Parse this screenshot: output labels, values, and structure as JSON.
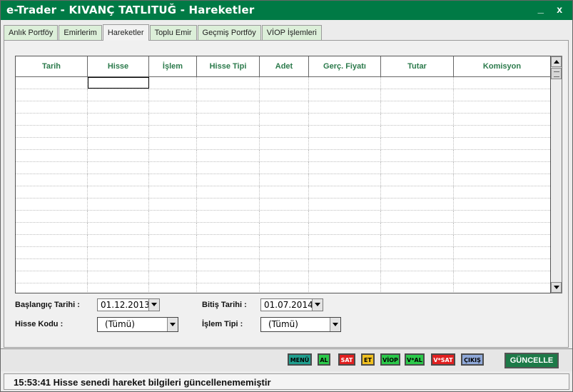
{
  "window": {
    "title": "e-Trader - KIVANÇ TATLITUĞ - Hareketler",
    "minimize_label": "_",
    "close_label": "x"
  },
  "tabs": [
    {
      "label": "Anlık Portföy",
      "active": false
    },
    {
      "label": "Emirlerim",
      "active": false
    },
    {
      "label": "Hareketler",
      "active": true
    },
    {
      "label": "Toplu Emir",
      "active": false
    },
    {
      "label": "Geçmiş Portföy",
      "active": false
    },
    {
      "label": "VİOP İşlemleri",
      "active": false
    }
  ],
  "grid": {
    "columns": [
      {
        "label": "Tarih"
      },
      {
        "label": "Hisse"
      },
      {
        "label": "İşlem"
      },
      {
        "label": "Hisse Tipi"
      },
      {
        "label": "Adet"
      },
      {
        "label": "Gerç. Fiyatı"
      },
      {
        "label": "Tutar"
      },
      {
        "label": "Komisyon"
      }
    ],
    "rows": []
  },
  "filters": {
    "start_date_label": "Başlangıç Tarihi :",
    "start_date_value": "01.12.2013",
    "end_date_label": "Bitiş Tarihi :",
    "end_date_value": "01.07.2014",
    "stock_code_label": "Hisse Kodu :",
    "stock_code_value": "(Tümü)",
    "transaction_type_label": "İşlem Tipi :",
    "transaction_type_value": "(Tümü)"
  },
  "quick_buttons": [
    {
      "label": "MENÜ",
      "bg": "#1f9e8e",
      "fg": "#000000"
    },
    {
      "label": "AL",
      "bg": "#2bc94a",
      "fg": "#000000"
    },
    {
      "label": "SAT",
      "bg": "#e02020",
      "fg": "#ffffff"
    },
    {
      "label": "ET",
      "bg": "#f0c020",
      "fg": "#000000"
    },
    {
      "label": "VİOP",
      "bg": "#2bc94a",
      "fg": "#000000"
    },
    {
      "label": "V*AL",
      "bg": "#2bc94a",
      "fg": "#000000"
    },
    {
      "label": "V*SAT",
      "bg": "#e02020",
      "fg": "#ffffff"
    },
    {
      "label": "ÇIKIŞ",
      "bg": "#8fa8d8",
      "fg": "#000000"
    }
  ],
  "refresh_button_label": "GÜNCELLE",
  "status": {
    "text": "15:53:41 Hisse senedi hareket bilgileri güncellenememiştir"
  },
  "colors": {
    "title_bar": "#007a45",
    "header_text": "#2b7a4b",
    "refresh_button": "#1d7a48"
  }
}
